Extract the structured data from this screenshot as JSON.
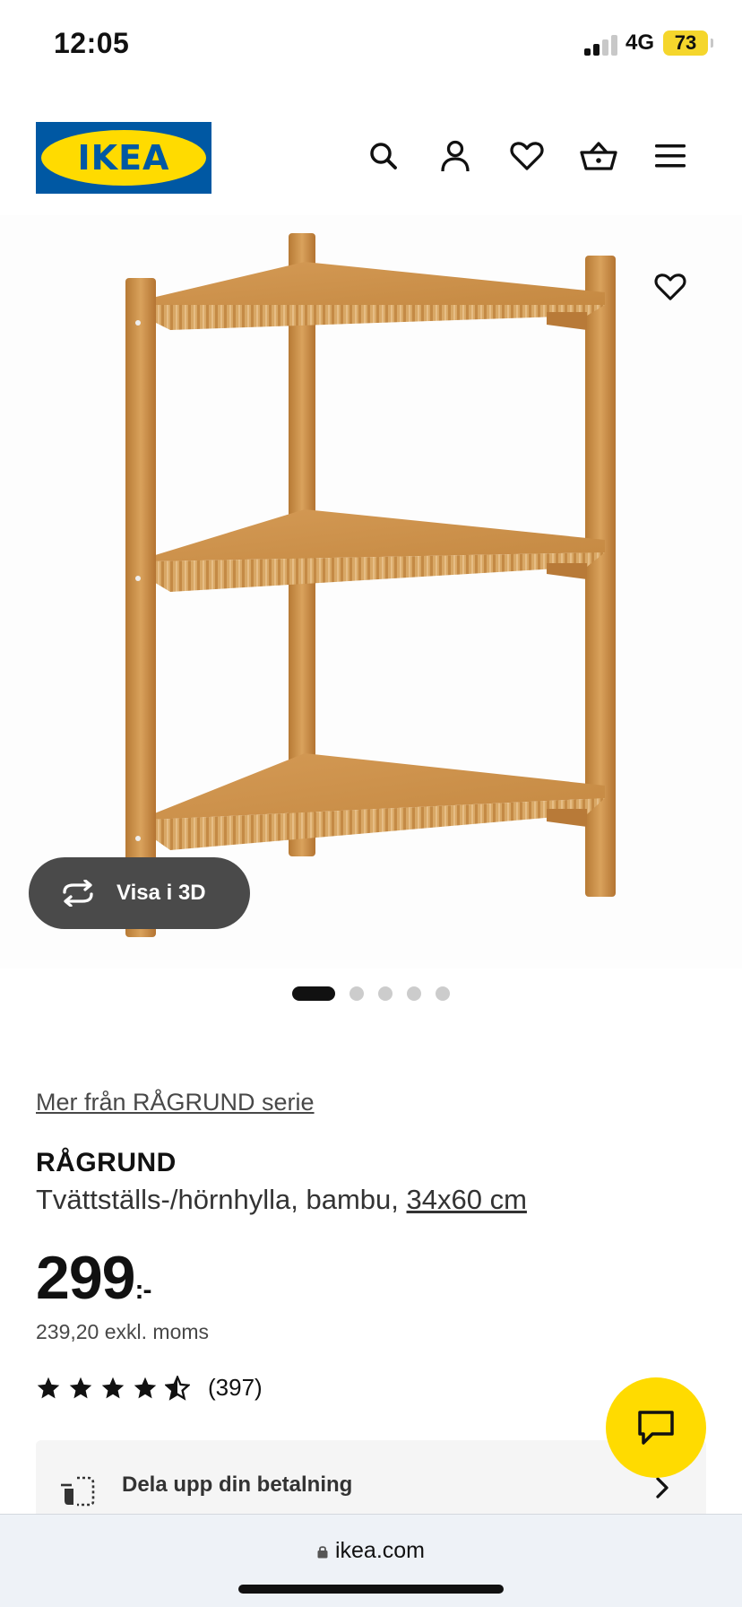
{
  "status_bar": {
    "time": "12:05",
    "network": "4G",
    "battery": "73"
  },
  "header": {
    "logo_text": "IKEA",
    "icons": [
      "search-icon",
      "account-icon",
      "heart-icon",
      "basket-icon",
      "menu-icon"
    ]
  },
  "gallery": {
    "view_3d_label": "Visa i 3D",
    "image_count": 5,
    "active_index": 0
  },
  "product": {
    "series_link": "Mer från RÅGRUND serie",
    "name": "RÅGRUND",
    "description": "Tvättställs-/hörnhylla, bambu, ",
    "size": "34x60 cm",
    "price": "299",
    "price_suffix": ":-",
    "price_ex_vat": "239,20 exkl. moms",
    "rating_stars": 4.5,
    "review_count": "(397)"
  },
  "payment": {
    "label": "Dela upp din betalning"
  },
  "browser": {
    "url": "ikea.com"
  },
  "colors": {
    "ikea_blue": "#0058a3",
    "ikea_yellow": "#ffdb00",
    "bamboo": "#c98a3e"
  }
}
